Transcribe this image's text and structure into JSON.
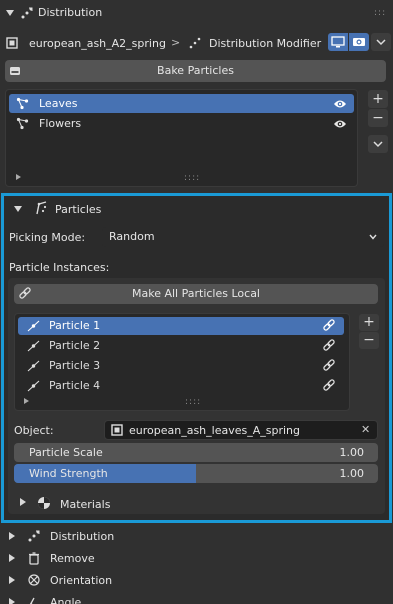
{
  "panel": {
    "title": "Distribution",
    "grip": ":::"
  },
  "header": {
    "object_name": "european_ash_A2_spring",
    "separator": ">",
    "modifier_name": "Distribution Modifier"
  },
  "bake_label": "Bake Particles",
  "systems": {
    "items": [
      {
        "label": "Leaves",
        "selected": true
      },
      {
        "label": "Flowers",
        "selected": false
      }
    ],
    "add": "+",
    "remove": "−",
    "grip": "::::"
  },
  "particles": {
    "title": "Particles",
    "picking_mode_label": "Picking Mode:",
    "picking_mode_value": "Random",
    "instances_label": "Particle Instances:",
    "make_local_label": "Make All Particles Local",
    "list": [
      {
        "label": "Particle 1",
        "selected": true
      },
      {
        "label": "Particle 2",
        "selected": false
      },
      {
        "label": "Particle 3",
        "selected": false
      },
      {
        "label": "Particle 4",
        "selected": false
      }
    ],
    "add": "+",
    "remove": "−",
    "grip": "::::",
    "object_label": "Object:",
    "object_value": "european_ash_leaves_A_spring",
    "clear": "✕",
    "scale_label": "Particle Scale",
    "scale_value": "1.00",
    "wind_label": "Wind Strength",
    "wind_value": "1.00",
    "wind_fill": 0.5,
    "materials_label": "Materials"
  },
  "sections": [
    {
      "label": "Distribution",
      "icon": "distribution-icon"
    },
    {
      "label": "Remove",
      "icon": "trash-icon"
    },
    {
      "label": "Orientation",
      "icon": "orientation-icon"
    },
    {
      "label": "Angle",
      "icon": "angle-icon"
    }
  ],
  "colors": {
    "accent_border": "#1a9ad6",
    "selected": "#4772b3",
    "background": "#303030"
  }
}
